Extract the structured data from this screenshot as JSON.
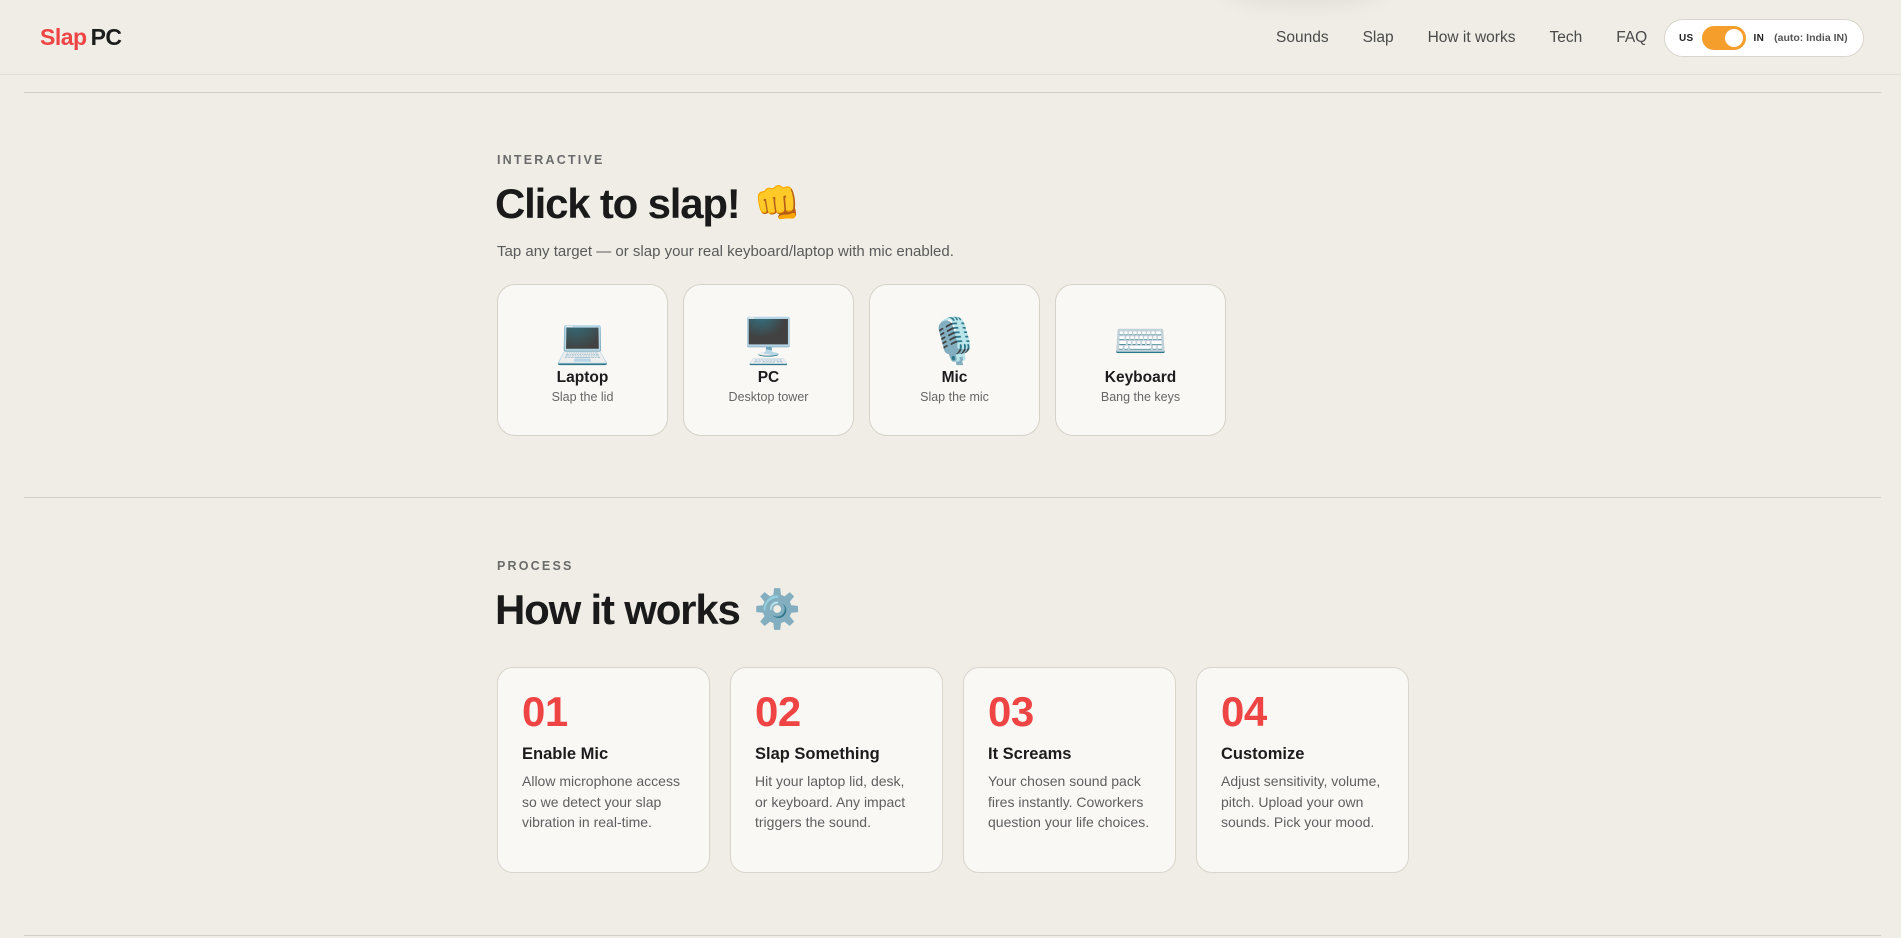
{
  "logo": {
    "part1": "Slap",
    "part2": "PC"
  },
  "nav": [
    "Sounds",
    "Slap",
    "How it works",
    "Tech",
    "FAQ"
  ],
  "region_toggle": {
    "left": "US",
    "right": "IN",
    "auto_label": "(auto: India IN)",
    "state": "on"
  },
  "colors": {
    "accent": "#ef4444",
    "toggle": "#f59e2b",
    "background": "#f0ede6"
  },
  "interactive": {
    "eyebrow": "INTERACTIVE",
    "title": "Click to slap!",
    "title_emoji": "👊",
    "subtitle": "Tap any target — or slap your real keyboard/laptop with mic enabled.",
    "targets": [
      {
        "icon": "💻",
        "icon_name": "laptop-icon",
        "name": "Laptop",
        "sub": "Slap the lid"
      },
      {
        "icon": "🖥️",
        "icon_name": "desktop-icon",
        "name": "PC",
        "sub": "Desktop tower"
      },
      {
        "icon": "🎙️",
        "icon_name": "microphone-icon",
        "name": "Mic",
        "sub": "Slap the mic"
      },
      {
        "icon": "⌨️",
        "icon_name": "keyboard-icon",
        "name": "Keyboard",
        "sub": "Bang the keys"
      }
    ]
  },
  "process": {
    "eyebrow": "PROCESS",
    "title": "How it works",
    "title_emoji": "⚙️",
    "steps": [
      {
        "num": "01",
        "title": "Enable Mic",
        "desc": "Allow microphone access so we detect your slap vibration in real-time."
      },
      {
        "num": "02",
        "title": "Slap Something",
        "desc": "Hit your laptop lid, desk, or keyboard. Any impact triggers the sound."
      },
      {
        "num": "03",
        "title": "It Screams",
        "desc": "Your chosen sound pack fires instantly. Coworkers question your life choices."
      },
      {
        "num": "04",
        "title": "Customize",
        "desc": "Adjust sensitivity, volume, pitch. Upload your own sounds. Pick your mood."
      }
    ]
  }
}
